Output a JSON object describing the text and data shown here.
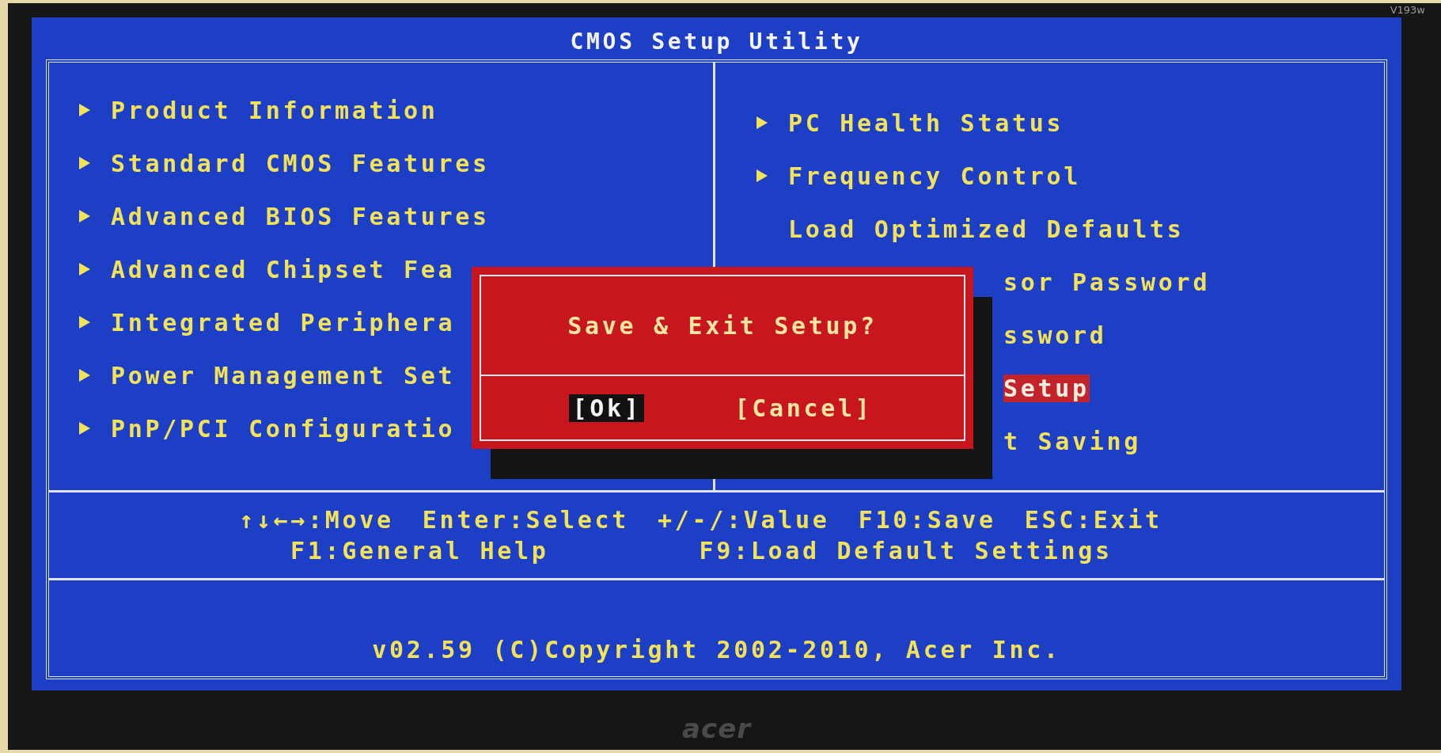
{
  "bezel": {
    "model": "V193w",
    "logo": "acer"
  },
  "screen": {
    "title": "CMOS Setup Utility",
    "left_menu": [
      {
        "label": "Product Information",
        "kind": "submenu",
        "selected": false
      },
      {
        "label": "Standard CMOS Features",
        "kind": "submenu",
        "selected": false
      },
      {
        "label": "Advanced BIOS Features",
        "kind": "submenu",
        "selected": false
      },
      {
        "label": "Advanced Chipset Fea",
        "kind": "submenu",
        "selected": false
      },
      {
        "label": "Integrated Periphera",
        "kind": "submenu",
        "selected": false
      },
      {
        "label": "Power Management Set",
        "kind": "submenu",
        "selected": false
      },
      {
        "label": "PnP/PCI Configuratio",
        "kind": "submenu",
        "selected": false
      }
    ],
    "right_menu": [
      {
        "label": "PC Health Status",
        "kind": "submenu",
        "selected": false
      },
      {
        "label": "Frequency Control",
        "kind": "submenu",
        "selected": false
      },
      {
        "label": "Load Optimized Defaults",
        "kind": "action",
        "selected": false
      },
      {
        "label": "sor Password",
        "kind": "covered",
        "selected": false
      },
      {
        "label": "ssword",
        "kind": "covered",
        "selected": false
      },
      {
        "label": "Setup",
        "kind": "covered",
        "selected": true
      },
      {
        "label": "t Saving",
        "kind": "covered",
        "selected": false
      }
    ],
    "key_help": [
      [
        "↑↓←→:Move",
        "Enter:Select",
        "+/-/:Value",
        "F10:Save",
        "ESC:Exit"
      ],
      [
        "F1:General Help",
        "F9:Load Default Settings"
      ]
    ],
    "footer": "v02.59 (C)Copyright 2002-2010, Acer Inc.",
    "dialog": {
      "message": "Save & Exit Setup?",
      "buttons": [
        {
          "label": "[Ok]",
          "selected": true
        },
        {
          "label": "[Cancel]",
          "selected": false
        }
      ]
    }
  }
}
